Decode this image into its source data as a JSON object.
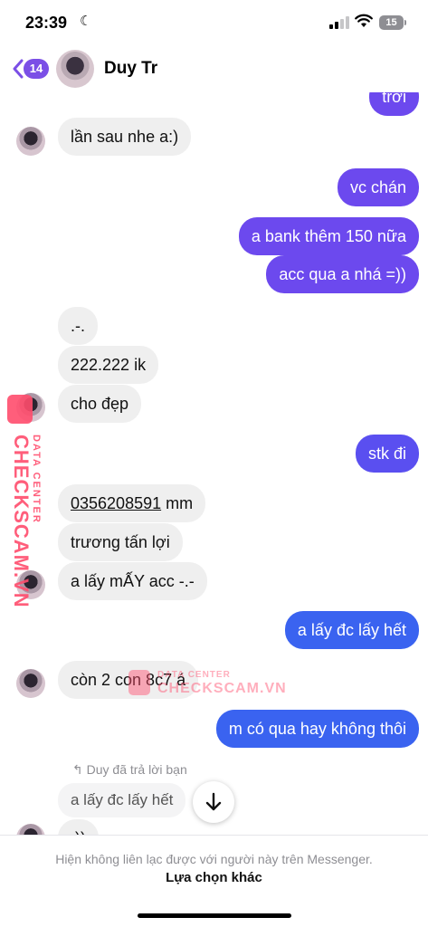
{
  "status_bar": {
    "time": "23:39",
    "battery": "15"
  },
  "header": {
    "back_count": "14",
    "contact_name": "Duy Tr"
  },
  "messages": {
    "top_partial": "trời",
    "m1": "lần sau nhe a:)",
    "m2": "vc chán",
    "m3": "a bank thêm 150 nữa",
    "m4": "acc qua a nhá =))",
    "m5": ".-.",
    "m6": "222.222 ik",
    "m7": "cho đẹp",
    "m8": "stk đi",
    "m9_number": "0356208591",
    "m9_suffix": " mm",
    "m10": "trương tấn lợi",
    "m11": "a lấy mẤY acc -.-",
    "m12": "a lấy đc lấy hết",
    "m13": "còn 2 con 8c7 á",
    "m14": "m có qua hay không thôi",
    "reply_note": "Duy đã trả lời bạn",
    "reply_quote": "a lấy đc lấy hết",
    "m15_partial": ":))"
  },
  "watermark": {
    "brand": "CHECKSCAM.VN",
    "sub": "DATA CENTER"
  },
  "footer": {
    "notice": "Hiện không liên lạc được với người này trên Messenger.",
    "action": "Lựa chọn khác"
  },
  "colors": {
    "outgoing_top": "#7b4fe6",
    "outgoing_bottom": "#3a63f0",
    "incoming": "#efefef",
    "watermark": "#ff4d6d"
  },
  "icons": {
    "back": "chevron-left-icon",
    "scroll": "arrow-down-icon",
    "reply": "reply-arrow-icon"
  }
}
